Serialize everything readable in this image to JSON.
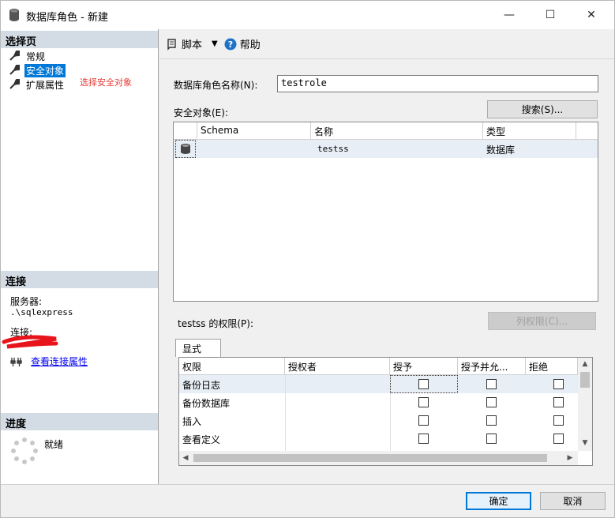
{
  "window": {
    "title": "数据库角色 - 新建",
    "minimize_glyph": "—",
    "maximize_glyph": "☐",
    "close_glyph": "✕"
  },
  "left": {
    "select_page_header": "选择页",
    "pages": [
      {
        "label": "常规",
        "selected": false
      },
      {
        "label": "安全对象",
        "selected": true
      },
      {
        "label": "扩展属性",
        "selected": false
      }
    ],
    "hint": "选择安全对象",
    "connection_header": "连接",
    "server_label": "服务器:",
    "server_value": ".\\sqlexpress",
    "connection_label": "连接:",
    "view_connection_link": "查看连接属性",
    "progress_header": "进度",
    "progress_status": "就绪"
  },
  "toolbar": {
    "script_label": "脚本",
    "dropdown_glyph": "▼",
    "help_label": "帮助"
  },
  "form": {
    "role_name_label": "数据库角色名称(N):",
    "role_name_value": "testrole",
    "securables_label": "安全对象(E):",
    "search_button": "搜索(S)...",
    "securables_columns": [
      "",
      "Schema",
      "名称",
      "类型"
    ],
    "securables_rows": [
      {
        "schema": "",
        "name": "testss",
        "type": "数据库"
      }
    ],
    "permissions_label": "testss 的权限(P):",
    "column_permissions_button": "列权限(C)...",
    "tab_label": "显式",
    "permissions_columns": [
      "权限",
      "授权者",
      "授予",
      "授予并允...",
      "拒绝"
    ],
    "permissions_rows": [
      {
        "permission": "备份日志",
        "grantor": "",
        "grant": false,
        "with_grant": false,
        "deny": false
      },
      {
        "permission": "备份数据库",
        "grantor": "",
        "grant": false,
        "with_grant": false,
        "deny": false
      },
      {
        "permission": "插入",
        "grantor": "",
        "grant": false,
        "with_grant": false,
        "deny": false
      },
      {
        "permission": "查看定义",
        "grantor": "",
        "grant": false,
        "with_grant": false,
        "deny": false
      }
    ]
  },
  "footer": {
    "ok_button": "确定",
    "cancel_button": "取消"
  }
}
